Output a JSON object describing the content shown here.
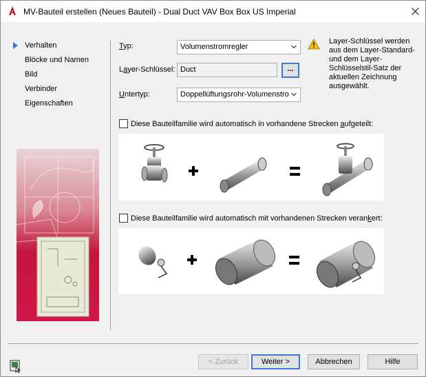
{
  "window": {
    "title": "MV-Bauteil erstellen (Neues Bauteil) - Dual Duct VAV Box Box US Imperial"
  },
  "nav": {
    "items": [
      {
        "label": "Verhalten",
        "active": true
      },
      {
        "label": "Blöcke und Namen",
        "active": false
      },
      {
        "label": "Bild",
        "active": false
      },
      {
        "label": "Verbinder",
        "active": false
      },
      {
        "label": "Eigenschaften",
        "active": false
      }
    ]
  },
  "form": {
    "typ_label_u": "T",
    "typ_label_rest": "yp:",
    "typ_value": "Volumenstromregler",
    "layer_label_pre": "L",
    "layer_label_u": "a",
    "layer_label_rest": "yer-Schlüssel:",
    "layer_value": "Duct",
    "browse_label": "...",
    "untertyp_label_u": "U",
    "untertyp_label_rest": "ntertyp:",
    "untertyp_value": "Doppellüftungsrohr-Volumenstro"
  },
  "info": {
    "text": "Layer-Schlüssel werden aus dem Layer-Standard- und dem Layer-Schlüsselstil-Satz der aktuellen Zeichnung ausgewählt."
  },
  "options": {
    "split_label_pre": "Diese Bauteilfamilie wird automatisch in vorhandene Strecken ",
    "split_label_u": "a",
    "split_label_post": "ufgeteilt:",
    "anchor_label_pre": "Diese Bauteilfamilie wird automatisch mit vorhandenen Strecken veran",
    "anchor_label_u": "k",
    "anchor_label_post": "ert:"
  },
  "buttons": {
    "back": "< Zurück",
    "next": "Weiter >",
    "cancel": "Abbrechen",
    "help": "Hilfe"
  },
  "colors": {
    "accent": "#3c7bd4",
    "nav_arrow": "#3a78d3",
    "app_icon": "#c8102e",
    "warning": "#f5c400"
  }
}
